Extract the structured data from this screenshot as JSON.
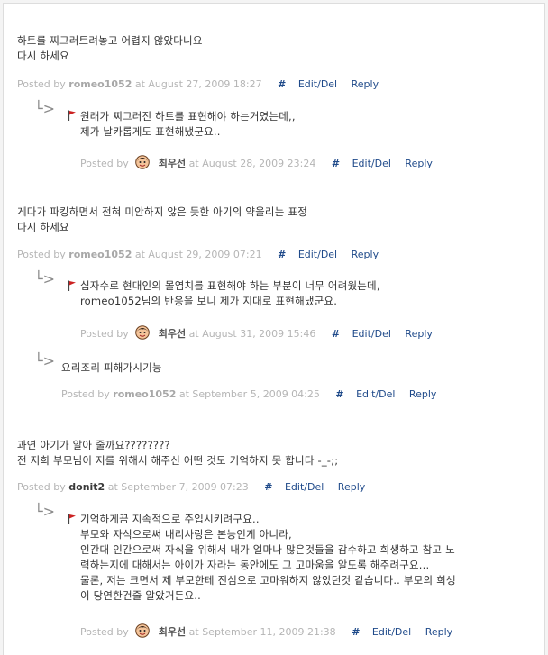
{
  "comments": [
    {
      "text": "하트를 찌그러트려놓고 어렵지 않았다니요\n다시 하세요",
      "posted_by_label": "Posted by",
      "author": "romeo1052",
      "at_label": "at",
      "date": "August 27, 2009 18:27",
      "hash": "#",
      "edit": "Edit/Del",
      "reply": "Reply"
    },
    {
      "text": "원래가 찌그러진 하트를 표현해야 하는거였는데,,\n제가 날카롭게도 표현해냈군요..",
      "posted_by_label": "Posted by",
      "author": "최우선",
      "at_label": "at",
      "date": "August 28, 2009 23:24",
      "hash": "#",
      "edit": "Edit/Del",
      "reply": "Reply"
    },
    {
      "text": "게다가 파킹하면서 전혀 미안하지 않은 듯한 아기의 약올리는 표정\n다시 하세요",
      "posted_by_label": "Posted by",
      "author": "romeo1052",
      "at_label": "at",
      "date": "August 29, 2009 07:21",
      "hash": "#",
      "edit": "Edit/Del",
      "reply": "Reply"
    },
    {
      "text": "십자수로 현대인의 몰염치를 표현해야 하는 부분이 너무 어려웠는데,\nromeo1052님의 반응을 보니 제가 지대로 표현해냈군요.",
      "posted_by_label": "Posted by",
      "author": "최우선",
      "at_label": "at",
      "date": "August 31, 2009 15:46",
      "hash": "#",
      "edit": "Edit/Del",
      "reply": "Reply"
    },
    {
      "text": "요리조리 피해가시기능",
      "posted_by_label": "Posted by",
      "author": "romeo1052",
      "at_label": "at",
      "date": "September 5, 2009 04:25",
      "hash": "#",
      "edit": "Edit/Del",
      "reply": "Reply"
    },
    {
      "text": "과연 아기가 알아 줄까요????????\n전 저희 부모님이 저를 위해서 해주신 어떤 것도 기억하지 못 합니다 -_-;;",
      "posted_by_label": "Posted by",
      "author": "donit2",
      "at_label": "at",
      "date": "September 7, 2009 07:23",
      "hash": "#",
      "edit": "Edit/Del",
      "reply": "Reply"
    },
    {
      "text": "기억하게끔 지속적으로 주입시키려구요..\n부모와 자식으로써 내리사랑은 본능인게 아니라,\n인간대 인간으로써 자식을 위해서 내가 얼마나 많은것들을 감수하고 희생하고 참고 노\n력하는지에 대해서는 아이가 자라는 동안에도 그 고마움을 알도록 해주려구요...\n물론, 저는 크면서 제 부모한테 진심으로 고마워하지 않았던것 같습니다.. 부모의 희생\n이 당연한건줄 알았거든요..",
      "posted_by_label": "Posted by",
      "author": "최우선",
      "at_label": "at",
      "date": "September 11, 2009 21:38",
      "hash": "#",
      "edit": "Edit/Del",
      "reply": "Reply"
    }
  ],
  "icons": {
    "reply_arrow": "reply-arrow-icon",
    "flag": "owner-flag-icon",
    "avatar": "smiley-avatar-icon"
  },
  "colors": {
    "link": "#1f4a8a",
    "meta": "#b5b5b5",
    "flag": "#cc2222"
  }
}
